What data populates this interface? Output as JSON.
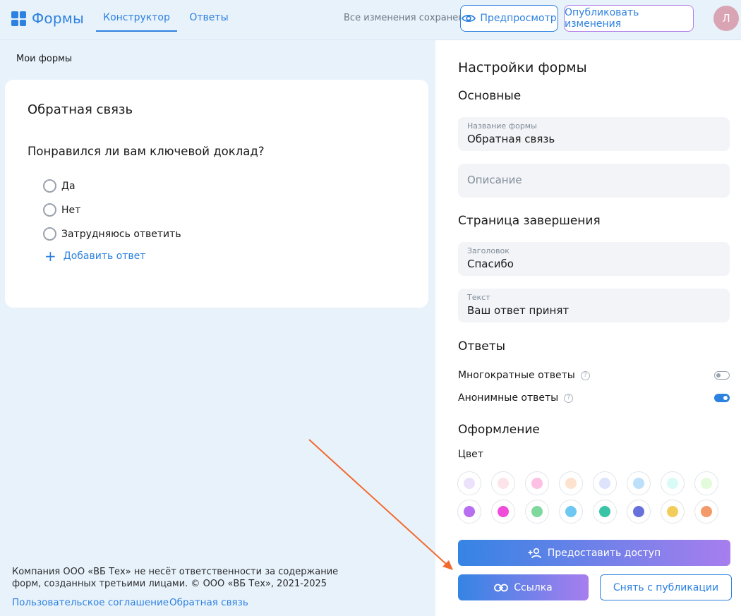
{
  "header": {
    "logo_text": "Формы",
    "tabs": [
      {
        "label": "Конструктор"
      },
      {
        "label": "Ответы"
      }
    ],
    "saved_status": "Все изменения сохранены",
    "preview_label": "Предпросмотр",
    "publish_label": "Опубликовать изменения",
    "avatar_initial": "Л"
  },
  "breadcrumb": "Мои формы",
  "form": {
    "title": "Обратная связь",
    "question": "Понравился ли вам ключевой доклад?",
    "options": [
      {
        "label": "Да"
      },
      {
        "label": "Нет"
      },
      {
        "label": "Затрудняюсь ответить"
      }
    ],
    "add_answer": "Добавить ответ"
  },
  "footer": {
    "disclaimer": "Компания ООО «ВБ Тех» не несёт ответственности за содержание форм, созданных третьими лицами. © ООО «ВБ Тех», 2021-2025",
    "links": [
      {
        "label": "Пользовательское соглашение"
      },
      {
        "label": "Обратная связь"
      }
    ]
  },
  "settings": {
    "title": "Настройки формы",
    "basic": {
      "title": "Основные",
      "name_label": "Название формы",
      "name_value": "Обратная связь",
      "description_placeholder": "Описание"
    },
    "completion": {
      "title": "Страница завершения",
      "heading_label": "Заголовок",
      "heading_value": "Спасибо",
      "text_label": "Текст",
      "text_value": "Ваш ответ принят"
    },
    "answers": {
      "title": "Ответы",
      "multiple": {
        "label": "Многократные ответы",
        "enabled": false
      },
      "anonymous": {
        "label": "Анонимные ответы",
        "enabled": true
      }
    },
    "design": {
      "title": "Оформление",
      "color_label": "Цвет",
      "colors_light": [
        "#ece2fb",
        "#fde4ea",
        "#fbc0e3",
        "#fde2cf",
        "#dce3fb",
        "#bde0fa",
        "#d8fbf8",
        "#e4fbdb"
      ],
      "colors_bright": [
        "#b86ef0",
        "#ef4dd9",
        "#7fd89c",
        "#6ec8f2",
        "#39c5a5",
        "#6671dc",
        "#f3cd5c",
        "#f39a68"
      ]
    },
    "share_label": "Предоставить доступ",
    "link_label": "Ссылка",
    "unpublish_label": "Снять с публикации"
  },
  "colors": {
    "accent": "#2d81e0",
    "annotation_arrow": "#f26a2e"
  }
}
